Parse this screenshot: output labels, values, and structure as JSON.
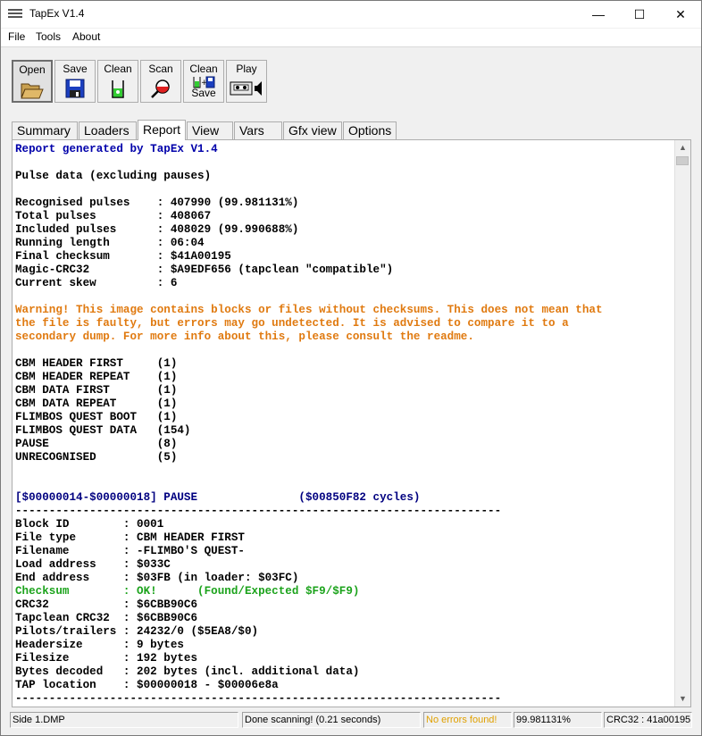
{
  "window": {
    "title": "TapEx V1.4"
  },
  "titlebar_buttons": {
    "minimize": "—",
    "maximize": "☐",
    "close": "✕"
  },
  "menu": [
    "File",
    "Tools",
    "About"
  ],
  "toolbar": [
    {
      "label": "Open",
      "icon": "open-folder-icon"
    },
    {
      "label": "Save",
      "icon": "floppy-disk-icon"
    },
    {
      "label": "Clean",
      "icon": "green-beaker-icon"
    },
    {
      "label": "Scan",
      "icon": "magnifier-icon"
    },
    {
      "label": "Clean",
      "label2": "Save",
      "icon": "clean-save-icon"
    },
    {
      "label": "Play",
      "icon": "tape-speaker-icon"
    }
  ],
  "tabs": [
    "Summary",
    "Loaders",
    "Report",
    "View",
    "Vars",
    "Gfx view",
    "Options"
  ],
  "active_tab": "Report",
  "report": {
    "header": "Report generated by TapEx V1.4",
    "pulse_heading": "Pulse data (excluding pauses)",
    "pulse_stats": [
      "Recognised pulses    : 407990 (99.981131%)",
      "Total pulses         : 408067",
      "Included pulses      : 408029 (99.990688%)",
      "Running length       : 06:04",
      "Final checksum       : $41A00195",
      "Magic-CRC32          : $A9EDF656 (tapclean \"compatible\")",
      "Current skew         : 6"
    ],
    "warning": [
      "Warning! This image contains blocks or files without checksums. This does not mean that",
      "the file is faulty, but errors may go undetected. It is advised to compare it to a",
      "secondary dump. For more info about this, please consult the readme."
    ],
    "file_counts": [
      "CBM HEADER FIRST     (1)",
      "CBM HEADER REPEAT    (1)",
      "CBM DATA FIRST       (1)",
      "CBM DATA REPEAT      (1)",
      "FLIMBOS QUEST BOOT   (1)",
      "FLIMBOS QUEST DATA   (154)",
      "PAUSE                (8)",
      "UNRECOGNISED         (5)"
    ],
    "pause_line": "[$00000014-$00000018] PAUSE               ($00850F82 cycles)",
    "separator": "------------------------------------------------------------------------",
    "block_a": [
      "Block ID        : 0001",
      "File type       : CBM HEADER FIRST",
      "Filename        : -FLIMBO'S QUEST-",
      "Load address    : $033C",
      "End address     : $03FB (in loader: $03FC)"
    ],
    "checksum_line": "Checksum        : OK!      (Found/Expected $F9/$F9)",
    "block_b": [
      "CRC32           : $6CBB90C6",
      "Tapclean CRC32  : $6CBB90C6",
      "Pilots/trailers : 24232/0 ($5EA8/$0)",
      "Headersize      : 9 bytes",
      "Filesize        : 192 bytes",
      "Bytes decoded   : 202 bytes (incl. additional data)",
      "TAP location    : $00000018 - $00006e8a"
    ]
  },
  "statusbar": {
    "file": "Side 1.DMP",
    "status": "Done scanning! (0.21 seconds)",
    "errors": "No errors found!",
    "percent": "99.981131%",
    "crc": "CRC32 : 41a00195"
  },
  "colors": {
    "report_blue": "#0000aa",
    "warning_orange": "#e07a10",
    "ok_green": "#1ca31c",
    "pause_navy": "#000080",
    "errors_text": "#e0a000"
  }
}
